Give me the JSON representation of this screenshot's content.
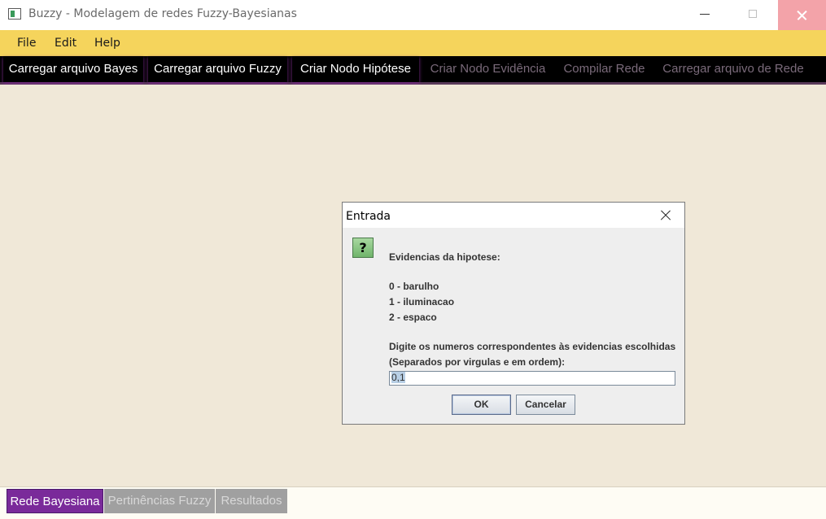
{
  "window": {
    "title": "Buzzy - Modelagem de redes Fuzzy-Bayesianas"
  },
  "menu": {
    "items": [
      "File",
      "Edit",
      "Help"
    ]
  },
  "toolbar": {
    "buttons": [
      {
        "label": "Carregar arquivo Bayes",
        "enabled": true
      },
      {
        "label": "Carregar arquivo Fuzzy",
        "enabled": true
      },
      {
        "label": "Criar Nodo Hipótese",
        "enabled": true
      },
      {
        "label": "Criar Nodo Evidência",
        "enabled": false
      },
      {
        "label": "Compilar Rede",
        "enabled": false
      },
      {
        "label": "Carregar arquivo de Rede",
        "enabled": false
      }
    ]
  },
  "dialog": {
    "title": "Entrada",
    "icon": "question-icon",
    "heading": "Evidencias da hipotese:",
    "options": [
      "0 - barulho",
      "1 - iluminacao",
      "2 - espaco"
    ],
    "instruction_line1": "Digite os numeros correspondentes às evidencias escolhidas",
    "instruction_line2": "(Separados por virgulas e em ordem):",
    "input_value": "0,1",
    "ok_label": "OK",
    "cancel_label": "Cancelar"
  },
  "bottom_tabs": [
    {
      "label": "Rede Bayesiana",
      "active": true
    },
    {
      "label": "Pertinências Fuzzy",
      "active": false
    },
    {
      "label": "Resultados",
      "active": false
    }
  ],
  "colors": {
    "menubar": "#f5d45c",
    "toolbar": "#000000",
    "workspace": "#f0e8d8",
    "active_tab": "#7a2a9a",
    "disabled_tab": "#a0a0a0"
  }
}
